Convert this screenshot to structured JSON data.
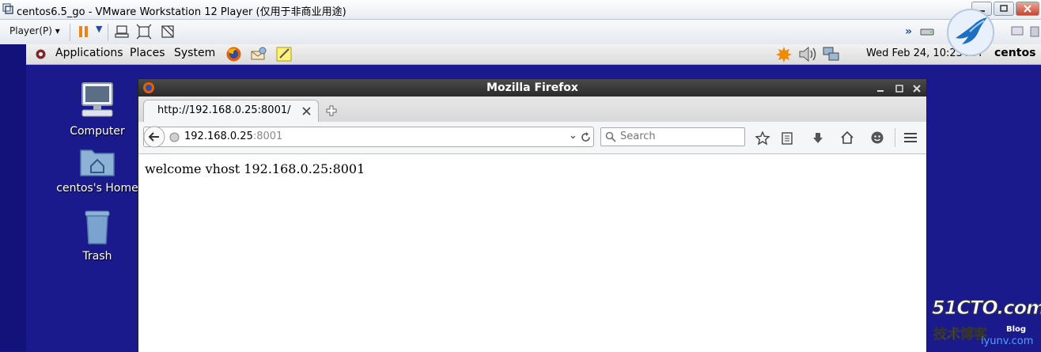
{
  "vmware": {
    "title": "centos6.5_go - VMware Workstation 12 Player (仅用于非商业用途)",
    "player_menu": "Player(P)"
  },
  "gnome_panel": {
    "menus": [
      "Applications",
      "Places",
      "System"
    ],
    "clock": "Wed Feb 24, 10:23 AM",
    "user": "centos"
  },
  "desktop": {
    "icons": [
      {
        "label": "Computer",
        "icon": "computer-icon"
      },
      {
        "label": "centos's Home",
        "icon": "home-folder-icon"
      },
      {
        "label": "Trash",
        "icon": "trash-icon"
      }
    ]
  },
  "firefox": {
    "window_title": "Mozilla Firefox",
    "tab_label": "http://192.168.0.25:8001/",
    "url_host": "192.168.0.25",
    "url_port": ":8001",
    "search_placeholder": "Search",
    "page_text": "welcome vhost 192.168.0.25:8001"
  },
  "watermark": {
    "brand": "51CTO.com",
    "sub": "技术博客",
    "tag": "Blog",
    "site": "iyunv.com"
  }
}
